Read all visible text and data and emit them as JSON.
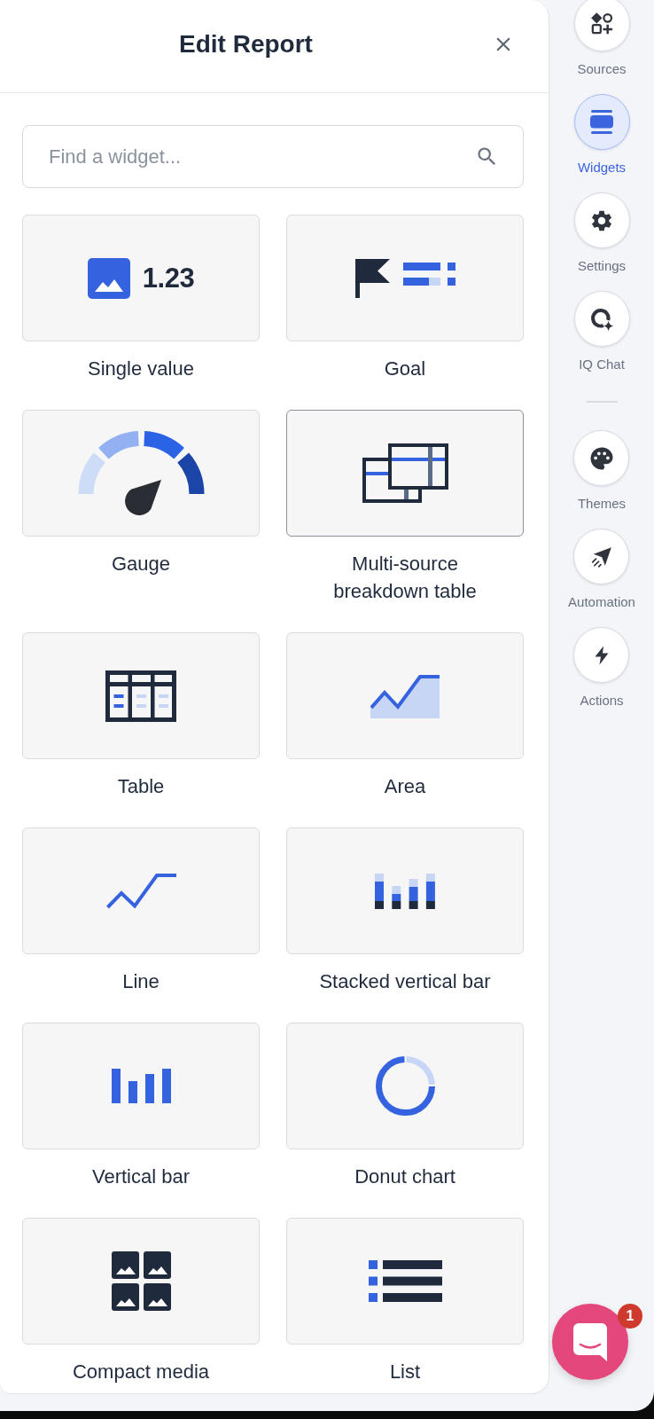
{
  "panel": {
    "title": "Edit Report"
  },
  "search": {
    "placeholder": "Find a widget..."
  },
  "widgets": [
    {
      "kind": "single_value",
      "label": "Single value",
      "preview_text": "1.23",
      "selected": false
    },
    {
      "kind": "goal",
      "label": "Goal",
      "selected": false
    },
    {
      "kind": "gauge",
      "label": "Gauge",
      "selected": false
    },
    {
      "kind": "multi_source",
      "label": "Multi-source breakdown table",
      "selected": true
    },
    {
      "kind": "table",
      "label": "Table",
      "selected": false
    },
    {
      "kind": "area",
      "label": "Area",
      "selected": false
    },
    {
      "kind": "line",
      "label": "Line",
      "selected": false
    },
    {
      "kind": "stacked_bar",
      "label": "Stacked vertical bar",
      "selected": false
    },
    {
      "kind": "vertical_bar",
      "label": "Vertical bar",
      "selected": false
    },
    {
      "kind": "donut",
      "label": "Donut chart",
      "selected": false
    },
    {
      "kind": "compact_media",
      "label": "Compact media",
      "selected": false
    },
    {
      "kind": "list",
      "label": "List",
      "selected": false
    }
  ],
  "sidebar": {
    "groups": [
      {
        "items": [
          {
            "kind": "sources",
            "label": "Sources",
            "selected": false
          },
          {
            "kind": "widgets",
            "label": "Widgets",
            "selected": true
          },
          {
            "kind": "settings",
            "label": "Settings",
            "selected": false
          },
          {
            "kind": "iq_chat",
            "label": "IQ Chat",
            "selected": false
          }
        ]
      },
      {
        "items": [
          {
            "kind": "themes",
            "label": "Themes",
            "selected": false
          },
          {
            "kind": "automation",
            "label": "Automation",
            "selected": false
          },
          {
            "kind": "actions",
            "label": "Actions",
            "selected": false
          }
        ]
      }
    ]
  },
  "chat_launcher": {
    "badge": "1"
  }
}
